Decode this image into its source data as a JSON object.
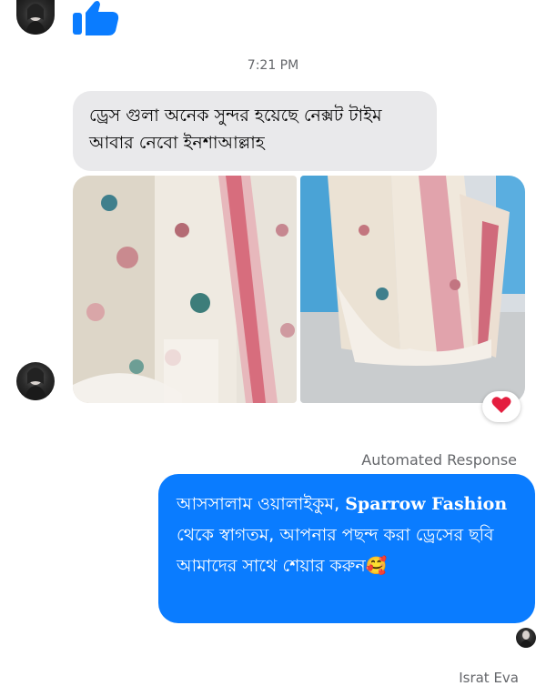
{
  "conversation": {
    "timestamp": "7:21 PM",
    "incoming_message": "ড্রেস গুলা অনেক সুন্দর হয়েছে নেক্সট টাইম আবার নেবো ইনশাআল্লাহ",
    "incoming_photos": [
      "photo-dress-fabric",
      "photo-dress-hanging"
    ],
    "reaction": "heart",
    "automated_label": "Automated Response",
    "reply": {
      "part1": "আসসালাম ওয়ালাইকুম, ",
      "brand": "Sparrow Fashion",
      "part2": " থেকে স্বাগতম, আপনার পছন্দ করা ড্রেসের ছবি আমাদের সাথে শেয়ার করুন",
      "emoji": "🥰"
    },
    "sender_name": "Israt Eva"
  },
  "colors": {
    "outgoing_bubble": "#0a7cff",
    "incoming_bubble": "#e9e9eb",
    "like_icon": "#0a7cff",
    "heart": "#e41e3f"
  },
  "icons": [
    "thumbs-up-icon",
    "heart-icon"
  ]
}
